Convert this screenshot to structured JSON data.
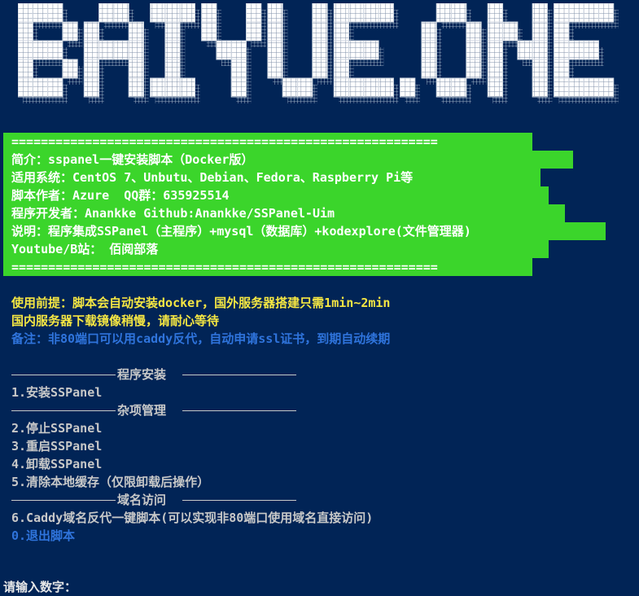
{
  "banner": {
    "text": "BAIYUE.ONE"
  },
  "info": {
    "rule_top": "==========================================================",
    "intro": "简介：sspanel一键安装脚本（Docker版）",
    "systems": "适用系统：CentOS 7、Unbutu、Debian、Fedora、Raspberry Pi等",
    "author": "脚本作者：Azure  QQ群：635925514",
    "developer": "程序开发者：Anankke Github:Anankke/SSPanel-Uim",
    "description": "说明：程序集成SSPanel（主程序）+mysql（数据库）+kodexplore(文件管理器)",
    "youtube": "Youtube/B站： 佰阅部落",
    "rule_bottom": "=========================================================="
  },
  "notes": {
    "prereq1": "使用前提：脚本会自动安装docker，国外服务器搭建只需1min~2min",
    "prereq2": "国内服务器下载镜像稍慢，请耐心等待",
    "remark": "备注：非80端口可以用caddy反代，自动申请ssl证书，到期自动续期"
  },
  "menu": {
    "section_install": "程序安装",
    "item1": "1.安装SSPanel",
    "section_manage": "杂项管理",
    "item2": "2.停止SSPanel",
    "item3": "3.重启SSPanel",
    "item4": "4.卸载SSPanel",
    "item5": "5.清除本地缓存（仅限卸载后操作）",
    "section_domain": "域名访问",
    "item6": "6.Caddy域名反代一键脚本(可以实现非80端口使用域名直接访问)",
    "item0": "0.退出脚本"
  },
  "prompt": {
    "text": "请输入数字："
  },
  "colors": {
    "background": "#012456",
    "green_block": "#3bd52b",
    "yellow": "#f5e643",
    "blue": "#2f74dc",
    "gray": "#c8c8c8"
  }
}
